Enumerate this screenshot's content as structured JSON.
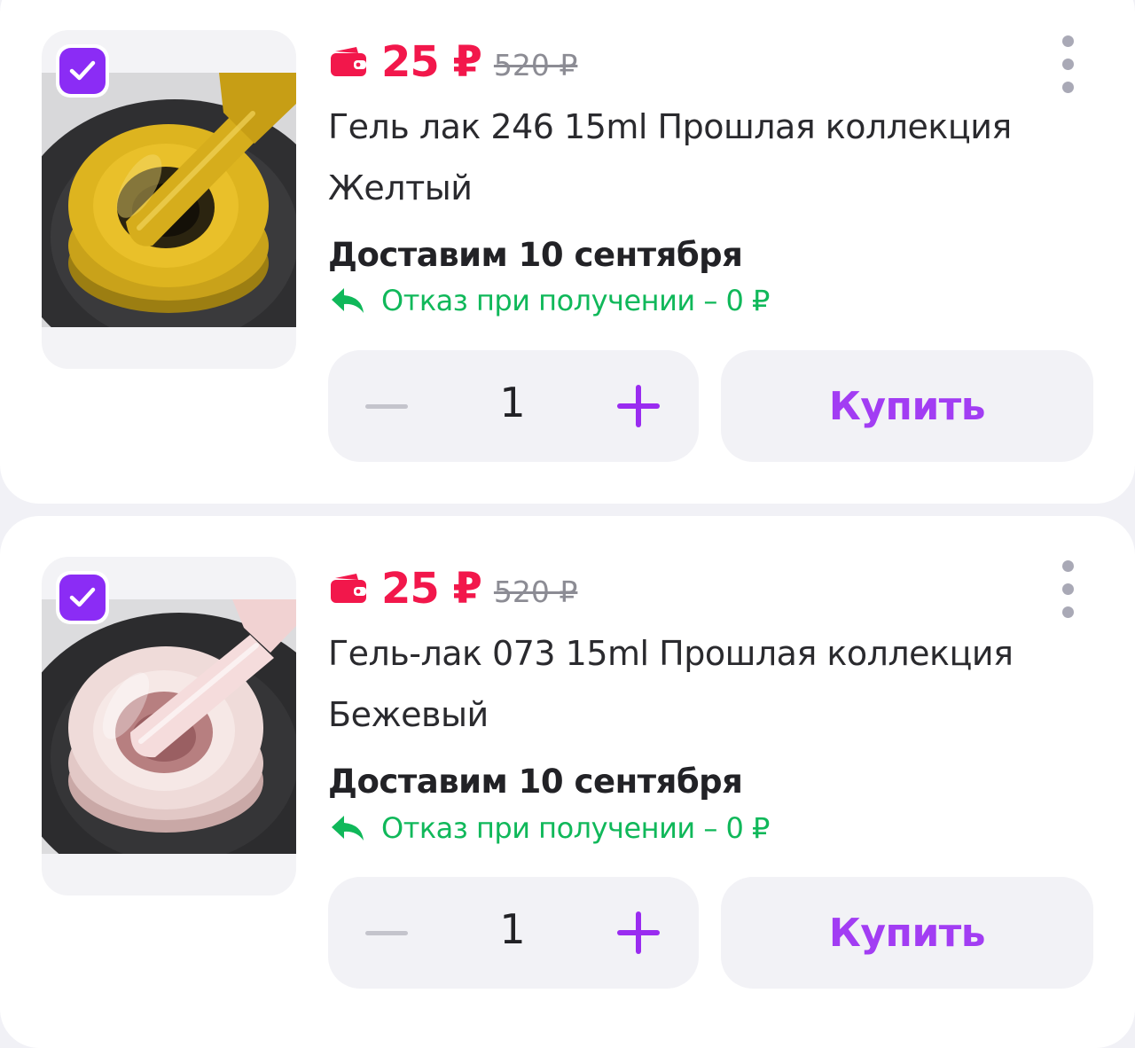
{
  "colors": {
    "background": "#f1f1f6",
    "card": "#ffffff",
    "price_accent": "#f2174b",
    "old_price": "#8c8c94",
    "checkbox": "#8b2cf5",
    "refund_green": "#10b85a",
    "buy_text": "#a23df3",
    "plus_icon": "#9a2cf0"
  },
  "products": [
    {
      "selected": true,
      "image_icon": "yellow-gel-polish-jar",
      "price": "25 ₽",
      "old_price": "520 ₽",
      "title": "Гель лак 246 15ml Прошлая коллекция Желтый",
      "delivery": "Доставим 10 сентября",
      "refusal": "Отказ при получении – 0 ₽",
      "quantity": "1",
      "buy_label": "Купить"
    },
    {
      "selected": true,
      "image_icon": "beige-gel-polish-jar",
      "price": "25 ₽",
      "old_price": "520 ₽",
      "title": "Гель-лак 073 15ml Прошлая коллекция Бежевый",
      "delivery": "Доставим 10 сентября",
      "refusal": "Отказ при получении – 0 ₽",
      "quantity": "1",
      "buy_label": "Купить"
    }
  ]
}
